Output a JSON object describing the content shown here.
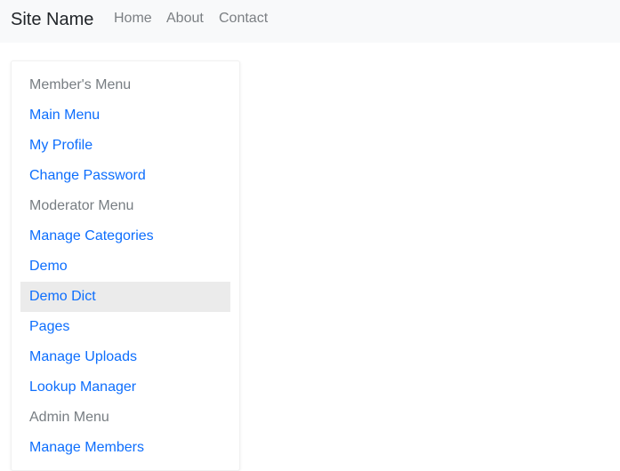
{
  "navbar": {
    "brand": "Site Name",
    "links": [
      {
        "label": "Home"
      },
      {
        "label": "About"
      },
      {
        "label": "Contact"
      }
    ]
  },
  "sidebar": {
    "items": [
      {
        "label": "Member's Menu",
        "type": "header"
      },
      {
        "label": "Main Menu",
        "type": "link"
      },
      {
        "label": "My Profile",
        "type": "link"
      },
      {
        "label": "Change Password",
        "type": "link"
      },
      {
        "label": "Moderator Menu",
        "type": "header"
      },
      {
        "label": "Manage Categories",
        "type": "link"
      },
      {
        "label": "Demo",
        "type": "link"
      },
      {
        "label": "Demo Dict",
        "type": "link",
        "active": true
      },
      {
        "label": "Pages",
        "type": "link"
      },
      {
        "label": "Manage Uploads",
        "type": "link"
      },
      {
        "label": "Lookup Manager",
        "type": "link"
      },
      {
        "label": "Admin Menu",
        "type": "header"
      },
      {
        "label": "Manage Members",
        "type": "link"
      }
    ]
  },
  "colors": {
    "link": "#0d6efd",
    "header_text": "#777d82",
    "active_background": "#ebebeb",
    "navbar_background": "#f8f9fa"
  }
}
